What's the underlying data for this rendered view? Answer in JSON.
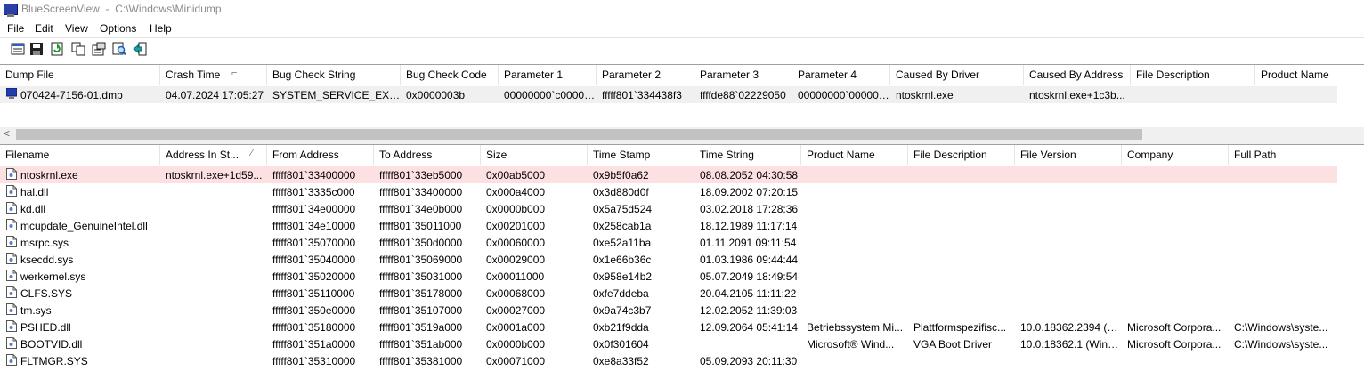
{
  "window": {
    "app_name": "BlueScreenView",
    "path": "C:\\Windows\\Minidump"
  },
  "menu": [
    "File",
    "Edit",
    "View",
    "Options",
    "Help"
  ],
  "toolbar": {
    "icons": [
      "options-icon",
      "save-icon",
      "refresh-icon",
      "copy-icon",
      "properties-icon",
      "find-icon",
      "exit-icon"
    ]
  },
  "dumps": {
    "columns": [
      "Dump File",
      "Crash Time",
      "Bug Check String",
      "Bug Check Code",
      "Parameter 1",
      "Parameter 2",
      "Parameter 3",
      "Parameter 4",
      "Caused By Driver",
      "Caused By Address",
      "File Description",
      "Product Name"
    ],
    "sort_column": "Crash Time",
    "rows": [
      [
        "070424-7156-01.dmp",
        "04.07.2024 17:05:27",
        "SYSTEM_SERVICE_EXCEP...",
        "0x0000003b",
        "00000000`c00000...",
        "fffff801`334438f3",
        "ffffde88`02229050",
        "00000000`000000...",
        "ntoskrnl.exe",
        "ntoskrnl.exe+1c3b...",
        "",
        ""
      ]
    ]
  },
  "modules": {
    "columns": [
      "Filename",
      "Address In St...",
      "From Address",
      "To Address",
      "Size",
      "Time Stamp",
      "Time String",
      "Product Name",
      "File Description",
      "File Version",
      "Company",
      "Full Path"
    ],
    "sort_column": "Address In St...",
    "rows": [
      [
        "ntoskrnl.exe",
        "ntoskrnl.exe+1d59...",
        "fffff801`33400000",
        "fffff801`33eb5000",
        "0x00ab5000",
        "0x9b5f0a62",
        "08.08.2052 04:30:58",
        "",
        "",
        "",
        "",
        ""
      ],
      [
        "hal.dll",
        "",
        "fffff801`3335c000",
        "fffff801`33400000",
        "0x000a4000",
        "0x3d880d0f",
        "18.09.2002 07:20:15",
        "",
        "",
        "",
        "",
        ""
      ],
      [
        "kd.dll",
        "",
        "fffff801`34e00000",
        "fffff801`34e0b000",
        "0x0000b000",
        "0x5a75d524",
        "03.02.2018 17:28:36",
        "",
        "",
        "",
        "",
        ""
      ],
      [
        "mcupdate_GenuineIntel.dll",
        "",
        "fffff801`34e10000",
        "fffff801`35011000",
        "0x00201000",
        "0x258cab1a",
        "18.12.1989 11:17:14",
        "",
        "",
        "",
        "",
        ""
      ],
      [
        "msrpc.sys",
        "",
        "fffff801`35070000",
        "fffff801`350d0000",
        "0x00060000",
        "0xe52a11ba",
        "01.11.2091 09:11:54",
        "",
        "",
        "",
        "",
        ""
      ],
      [
        "ksecdd.sys",
        "",
        "fffff801`35040000",
        "fffff801`35069000",
        "0x00029000",
        "0x1e66b36c",
        "01.03.1986 09:44:44",
        "",
        "",
        "",
        "",
        ""
      ],
      [
        "werkernel.sys",
        "",
        "fffff801`35020000",
        "fffff801`35031000",
        "0x00011000",
        "0x958e14b2",
        "05.07.2049 18:49:54",
        "",
        "",
        "",
        "",
        ""
      ],
      [
        "CLFS.SYS",
        "",
        "fffff801`35110000",
        "fffff801`35178000",
        "0x00068000",
        "0xfe7ddeba",
        "20.04.2105 11:11:22",
        "",
        "",
        "",
        "",
        ""
      ],
      [
        "tm.sys",
        "",
        "fffff801`350e0000",
        "fffff801`35107000",
        "0x00027000",
        "0x9a74c3b7",
        "12.02.2052 11:39:03",
        "",
        "",
        "",
        "",
        ""
      ],
      [
        "PSHED.dll",
        "",
        "fffff801`35180000",
        "fffff801`3519a000",
        "0x0001a000",
        "0xb21f9dda",
        "12.09.2064 05:41:14",
        "Betriebssystem Mi...",
        "Plattformspezifisc...",
        "10.0.18362.2394 (W...",
        "Microsoft Corpora...",
        "C:\\Windows\\syste..."
      ],
      [
        "BOOTVID.dll",
        "",
        "fffff801`351a0000",
        "fffff801`351ab000",
        "0x0000b000",
        "0x0f301604",
        "",
        "Microsoft® Wind...",
        "VGA Boot Driver",
        "10.0.18362.1 (WinB...",
        "Microsoft Corpora...",
        "C:\\Windows\\syste..."
      ],
      [
        "FLTMGR.SYS",
        "",
        "fffff801`35310000",
        "fffff801`35381000",
        "0x00071000",
        "0xe8a33f52",
        "05.09.2093 20:11:30",
        "",
        "",
        "",
        "",
        ""
      ]
    ]
  },
  "colors": {
    "highlight_row": "#fde0e2",
    "selected_row": "#f0f0f0",
    "title_gray": "#8a8a8a"
  }
}
